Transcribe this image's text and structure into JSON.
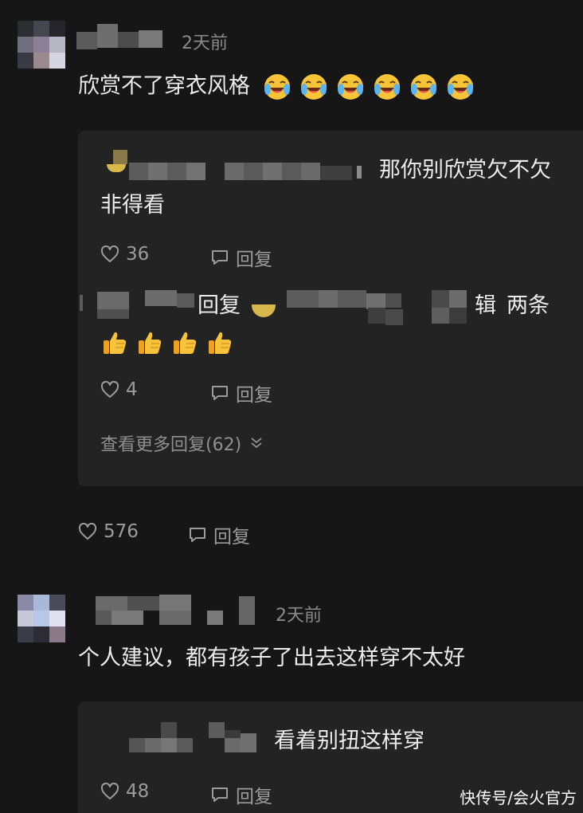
{
  "comment1": {
    "time": "2天前",
    "text": "欣赏不了穿衣风格",
    "emoji": [
      "crying-laughing",
      "crying-laughing",
      "crying-laughing",
      "crying-laughing",
      "crying-laughing",
      "crying-laughing"
    ],
    "likes": "576",
    "reply_label": "回复",
    "replies": [
      {
        "text_line1": "那你别欣赏欠不欠",
        "text_line2": "非得看",
        "likes": "36",
        "reply_label": "回复"
      },
      {
        "reply_word": "回复",
        "name_tail": "辑",
        "text": "两条",
        "emoji": [
          "thumbs-up",
          "thumbs-up",
          "thumbs-up",
          "thumbs-up"
        ],
        "likes": "4",
        "reply_label": "回复"
      }
    ],
    "more_replies": "查看更多回复(62)"
  },
  "comment2": {
    "time": "2天前",
    "text": "个人建议，都有孩子了出去这样穿不太好",
    "replies": [
      {
        "text": "看着别扭这样穿",
        "likes": "48",
        "reply_label": "回复"
      }
    ]
  },
  "watermark": "快传号/会火官方"
}
